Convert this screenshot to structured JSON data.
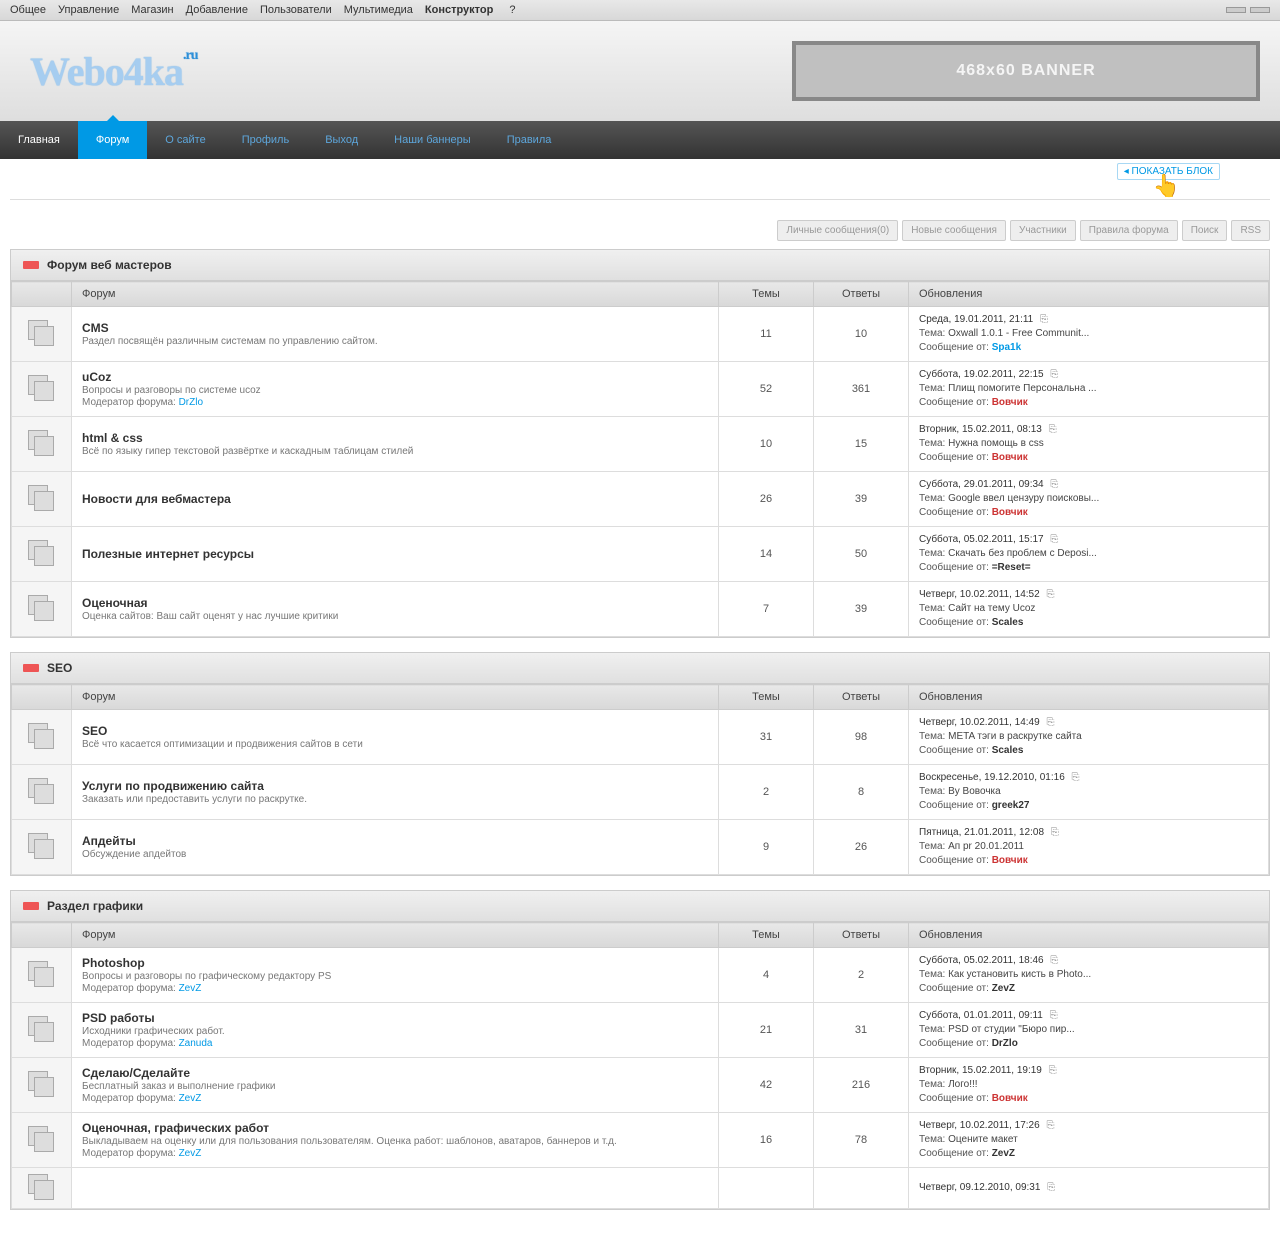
{
  "adminBar": {
    "items": [
      "Общее",
      "Управление",
      "Магазин",
      "Добавление",
      "Пользователи",
      "Мультимедиа",
      "Конструктор"
    ],
    "help": "?"
  },
  "logo": "Webo4ka",
  "banner": "468x60 BANNER",
  "nav": {
    "items": [
      {
        "label": "Главная",
        "active": false,
        "grey": true
      },
      {
        "label": "Форум",
        "active": true
      },
      {
        "label": "О сайте",
        "active": false
      },
      {
        "label": "Профиль",
        "active": false
      },
      {
        "label": "Выход",
        "active": false
      },
      {
        "label": "Наши баннеры",
        "active": false
      },
      {
        "label": "Правила",
        "active": false
      }
    ]
  },
  "showBlock": "ПОКАЗАТЬ БЛОК",
  "toolbar": [
    "Личные сообщения(0)",
    "Новые сообщения",
    "Участники",
    "Правила форума",
    "Поиск",
    "RSS"
  ],
  "cols": {
    "forum": "Форум",
    "topics": "Темы",
    "replies": "Ответы",
    "updates": "Обновления"
  },
  "labels": {
    "tema": "Тема:",
    "msgFrom": "Сообщение от:",
    "mod": "Модератор форума:"
  },
  "categories": [
    {
      "title": "Форум веб мастеров",
      "forums": [
        {
          "name": "CMS",
          "desc": "Раздел посвящён различным системам по управлению сайтом.",
          "topics": "11",
          "replies": "10",
          "date": "Среда, 19.01.2011, 21:11",
          "topic": "Oxwall 1.0.1 - Free Communit...",
          "author": "Spa1k",
          "cls": "author-blue"
        },
        {
          "name": "uCoz",
          "desc": "Вопросы и разговоры по системе ucoz",
          "mod": "DrZlo",
          "topics": "52",
          "replies": "361",
          "date": "Суббота, 19.02.2011, 22:15",
          "topic": "Плищ помогите Персональна ...",
          "author": "Вовчик",
          "cls": "author-red"
        },
        {
          "name": "html & css",
          "desc": "Всё по языку гипер текстовой развёртке и каскадным таблицам стилей",
          "topics": "10",
          "replies": "15",
          "date": "Вторник, 15.02.2011, 08:13",
          "topic": "Нужна помощь в css",
          "author": "Вовчик",
          "cls": "author-red"
        },
        {
          "name": "Новости для вебмастера",
          "desc": "",
          "topics": "26",
          "replies": "39",
          "date": "Суббота, 29.01.2011, 09:34",
          "topic": "Google ввел цензуру поисковы...",
          "author": "Вовчик",
          "cls": "author-red"
        },
        {
          "name": "Полезные интернет ресурсы",
          "desc": "",
          "topics": "14",
          "replies": "50",
          "date": "Суббота, 05.02.2011, 15:17",
          "topic": "Скачать без проблем с Deposi...",
          "author": "=Reset=",
          "cls": "author-b"
        },
        {
          "name": "Оценочная",
          "desc": "Оценка сайтов: Ваш сайт оценят у нас лучшие критики",
          "topics": "7",
          "replies": "39",
          "date": "Четверг, 10.02.2011, 14:52",
          "topic": "Сайт на тему Ucoz",
          "author": "Scales",
          "cls": "author-b"
        }
      ]
    },
    {
      "title": "SEO",
      "forums": [
        {
          "name": "SEO",
          "desc": "Всё что касается оптимизации и продвижения сайтов в сети",
          "topics": "31",
          "replies": "98",
          "date": "Четверг, 10.02.2011, 14:49",
          "topic": "META тэги в раскрутке сайта",
          "author": "Scales",
          "cls": "author-b"
        },
        {
          "name": "Услуги по продвижению сайта",
          "desc": "Заказать или предоставить услуги по раскрутке.",
          "topics": "2",
          "replies": "8",
          "date": "Воскресенье, 19.12.2010, 01:16",
          "topic": "By Вовочка",
          "author": "greek27",
          "cls": "author-b"
        },
        {
          "name": "Апдейты",
          "desc": "Обсуждение апдейтов",
          "topics": "9",
          "replies": "26",
          "date": "Пятница, 21.01.2011, 12:08",
          "topic": "Ап pr 20.01.2011",
          "author": "Вовчик",
          "cls": "author-red"
        }
      ]
    },
    {
      "title": "Раздел графики",
      "forums": [
        {
          "name": "Photoshop",
          "desc": "Вопросы и разговоры по графическому редактору PS",
          "mod": "ZevZ",
          "topics": "4",
          "replies": "2",
          "date": "Суббота, 05.02.2011, 18:46",
          "topic": "Как установить кисть в Photo...",
          "author": "ZevZ",
          "cls": "author-b"
        },
        {
          "name": "PSD работы",
          "desc": "Исходники графических работ.",
          "mod": "Zanuda",
          "topics": "21",
          "replies": "31",
          "date": "Суббота, 01.01.2011, 09:11",
          "topic": "PSD от студии \"Бюро пир...",
          "author": "DrZlo",
          "cls": "author-b"
        },
        {
          "name": "Сделаю/Сделайте",
          "desc": "Бесплатный заказ и выполнение графики",
          "mod": "ZevZ",
          "topics": "42",
          "replies": "216",
          "date": "Вторник, 15.02.2011, 19:19",
          "topic": "Лого!!!",
          "author": "Вовчик",
          "cls": "author-red"
        },
        {
          "name": "Оценочная, графических работ",
          "desc": "Выкладываем на оценку или для пользования пользователям. Оценка работ: шаблонов, аватаров, баннеров и т.д.",
          "mod": "ZevZ",
          "topics": "16",
          "replies": "78",
          "date": "Четверг, 10.02.2011, 17:26",
          "topic": "Оцените макет",
          "author": "ZevZ",
          "cls": "author-b"
        },
        {
          "name": "",
          "desc": "",
          "topics": "",
          "replies": "",
          "date": "Четверг, 09.12.2010, 09:31",
          "topic": "",
          "author": "",
          "cls": "author-b"
        }
      ]
    }
  ]
}
